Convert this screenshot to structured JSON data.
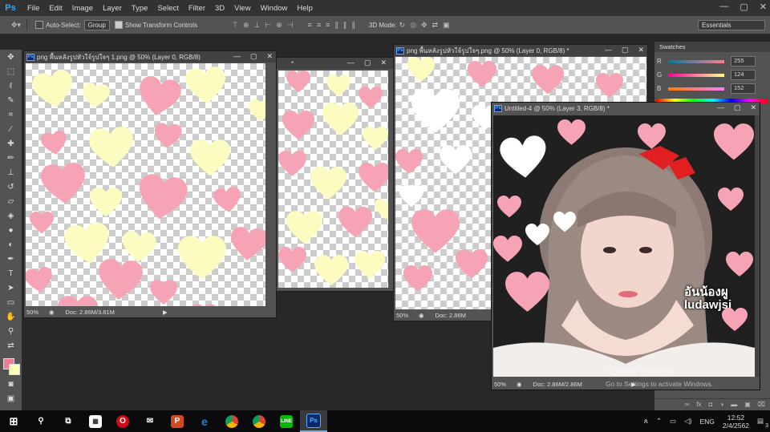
{
  "app": {
    "logo": "Ps"
  },
  "menu": [
    "File",
    "Edit",
    "Image",
    "Layer",
    "Type",
    "Select",
    "Filter",
    "3D",
    "View",
    "Window",
    "Help"
  ],
  "window_controls": [
    "—",
    "▢",
    "✕"
  ],
  "options_bar": {
    "auto_select_label": "Auto-Select:",
    "auto_select_value": "Group",
    "show_transform_label": "Show Transform Controls",
    "mode_label": "3D Mode:",
    "workspace": "Essentials"
  },
  "colors": {
    "foreground": "#f27a93",
    "background": "#fefdb8"
  },
  "swatches_panel": {
    "tab_label": "Swatches",
    "sliders": [
      {
        "channel": "R",
        "value": "255"
      },
      {
        "channel": "G",
        "value": "124"
      },
      {
        "channel": "B",
        "value": "152"
      }
    ]
  },
  "documents": [
    {
      "title": "png พื้นหลังรูปหัวใจ์รูปใจๆ 1.png @ 50% (Layer 0, RGB/8)",
      "zoom": "50%",
      "doc": "Doc: 2.86M/3.81M"
    },
    {
      "title": "*"
    },
    {
      "title": "png พื้นหลังรูปหัวใจ์รูปใจๆ.png @ 50% (Layer 0, RGB/8) *",
      "zoom": "50%",
      "doc": "Doc: 2.86M"
    },
    {
      "title": "Untitled-4 @ 50% (Layer 3, RGB/8) *",
      "zoom": "50%",
      "doc": "Doc: 2.86M/2.86M",
      "overlay_text": [
        "อันน้องผู",
        "ludawjsi"
      ]
    }
  ],
  "watermark": {
    "line1": "Activate Windows",
    "line2": "Go to Settings to activate Windows."
  },
  "taskbar": {
    "apps": [
      "start",
      "search",
      "task-view",
      "store",
      "opera",
      "mail",
      "powerpoint",
      "edge",
      "chrome",
      "chrome",
      "line",
      "photoshop"
    ],
    "language": "ENG",
    "time": "12:52",
    "date": "2/4/2562",
    "notification_count": "3"
  }
}
